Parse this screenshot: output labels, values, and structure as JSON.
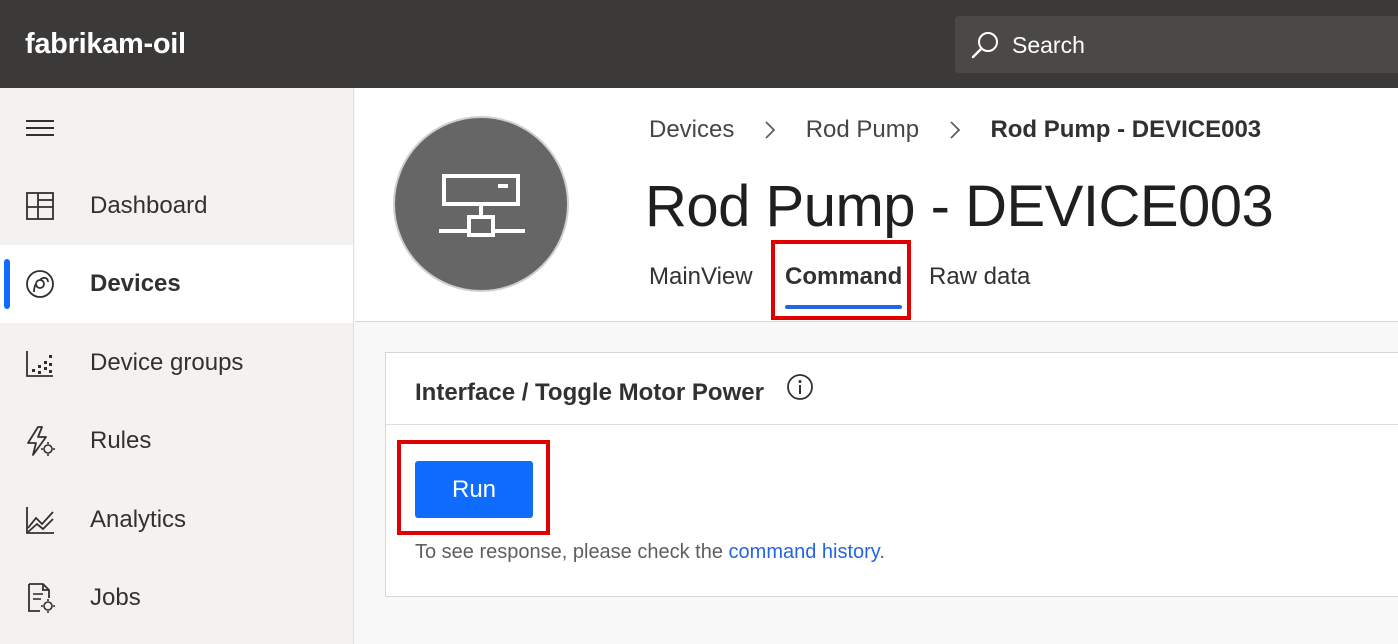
{
  "app": {
    "title": "fabrikam-oil"
  },
  "search": {
    "label": "Search"
  },
  "sidebar": {
    "items": [
      {
        "label": "Dashboard",
        "icon": "dashboard-icon",
        "active": false
      },
      {
        "label": "Devices",
        "icon": "devices-icon",
        "active": true
      },
      {
        "label": "Device groups",
        "icon": "device-groups-icon",
        "active": false
      },
      {
        "label": "Rules",
        "icon": "rules-icon",
        "active": false
      },
      {
        "label": "Analytics",
        "icon": "analytics-icon",
        "active": false
      },
      {
        "label": "Jobs",
        "icon": "jobs-icon",
        "active": false
      }
    ]
  },
  "breadcrumb": [
    "Devices",
    "Rod Pump",
    "Rod Pump - DEVICE003"
  ],
  "device": {
    "title": "Rod Pump - DEVICE003",
    "icon": "device-icon"
  },
  "tabs": [
    {
      "label": "MainView",
      "active": false
    },
    {
      "label": "Command",
      "active": true
    },
    {
      "label": "Raw data",
      "active": false
    }
  ],
  "command": {
    "title": "Interface / Toggle Motor Power",
    "run_label": "Run",
    "helper_prefix": "To see response, please check the ",
    "helper_link": "command history",
    "helper_suffix": "."
  },
  "colors": {
    "topbar": "#3b3a39",
    "accent": "#0f6cff",
    "link": "#2266e3",
    "highlight": "#e00000"
  }
}
